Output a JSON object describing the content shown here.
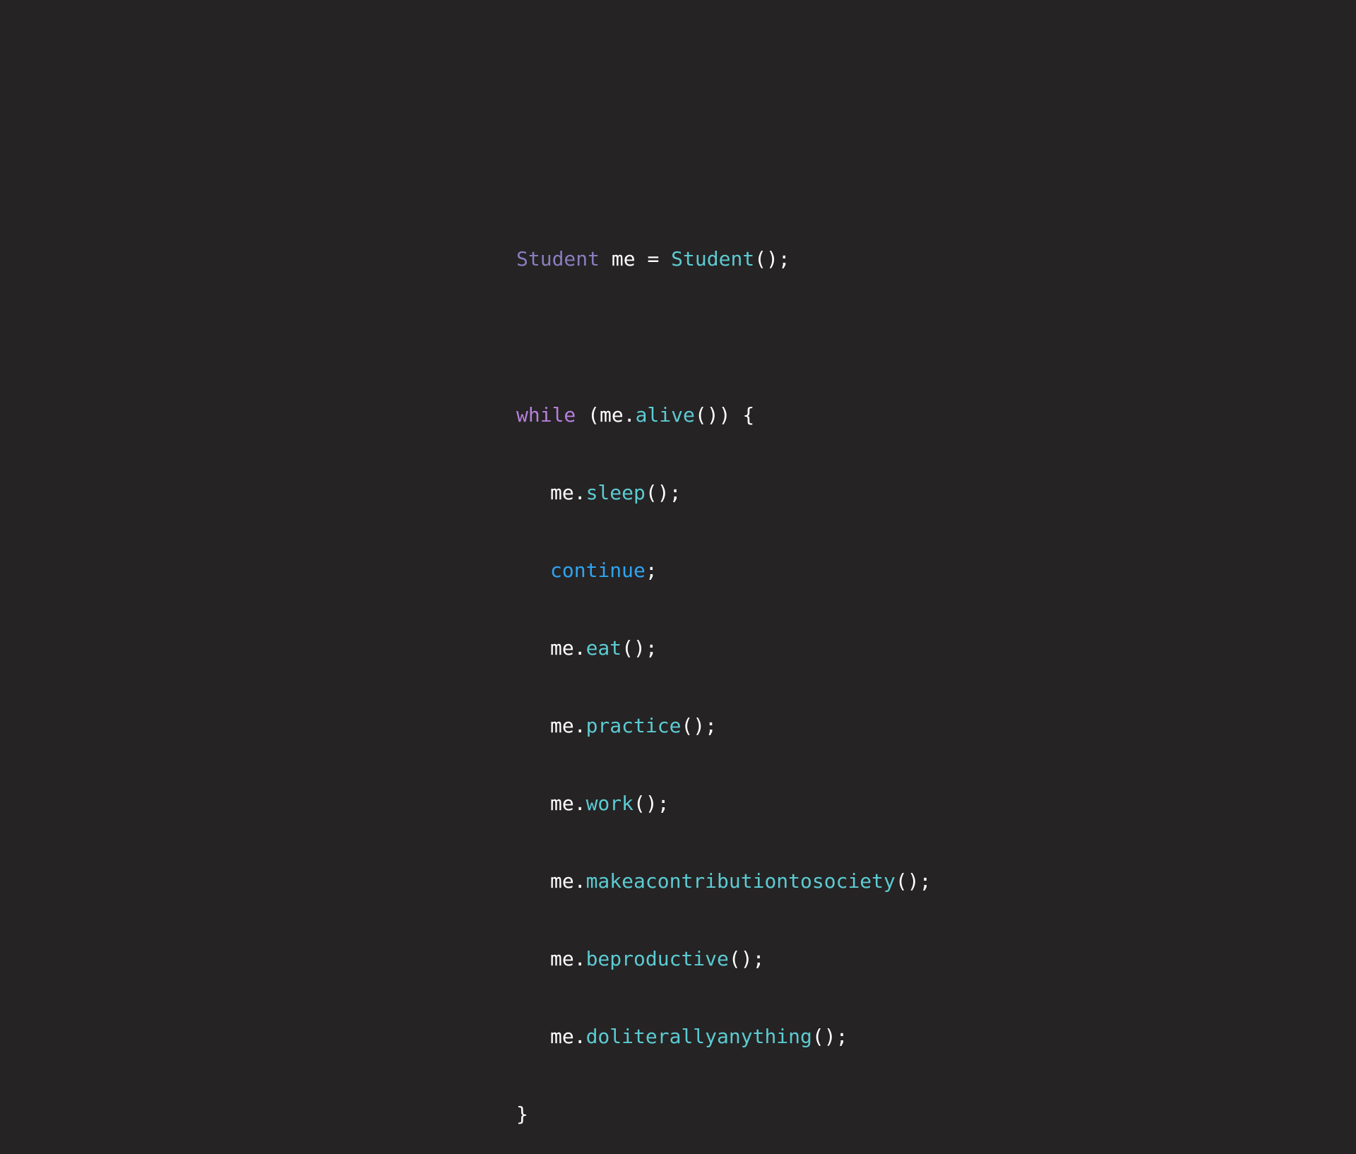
{
  "code": {
    "declaration": {
      "type": "Student",
      "var": "me",
      "op": "=",
      "ctor": "Student",
      "tail": "();"
    },
    "loop": {
      "keyword": "while",
      "open": "(me.",
      "cond": "alive",
      "close": "()) {"
    },
    "body": [
      {
        "obj": "me.",
        "method": "sleep",
        "tail": "();"
      },
      {
        "keyword": "continue",
        "tail": ";"
      },
      {
        "obj": "me.",
        "method": "eat",
        "tail": "();"
      },
      {
        "obj": "me.",
        "method": "practice",
        "tail": "();"
      },
      {
        "obj": "me.",
        "method": "work",
        "tail": "();"
      },
      {
        "obj": "me.",
        "method": "makeacontributiontosociety",
        "tail": "();"
      },
      {
        "obj": "me.",
        "method": "beproductive",
        "tail": "();"
      },
      {
        "obj": "me.",
        "method": "doliterallyanything",
        "tail": "();"
      }
    ],
    "closing": "}"
  },
  "colors": {
    "background": "#252324",
    "type": "#8a7dbf",
    "function": "#5ccbd2",
    "keyword": "#b77fdc",
    "control": "#2fa4f0",
    "plain": "#ffffff"
  }
}
